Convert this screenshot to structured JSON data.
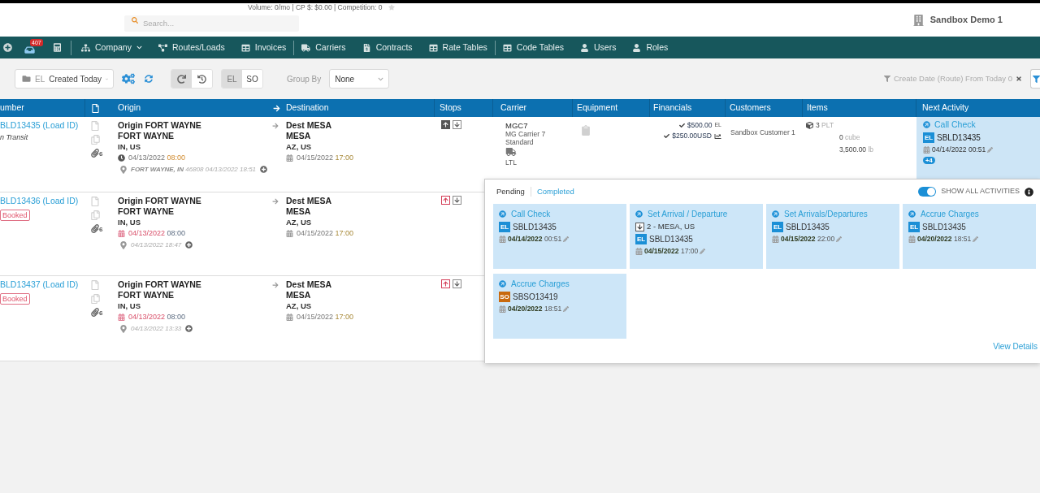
{
  "banner": {
    "text": "Volume: 0/mo | CP $: $0.00 | Competition: 0"
  },
  "header": {
    "search": {
      "placeholder": "Search..."
    },
    "account": "Sandbox Demo 1"
  },
  "nav": {
    "notifications": "407",
    "groups": [
      [
        {
          "label": "Company",
          "has_menu": true
        },
        {
          "label": "Routes/Loads",
          "has_menu": false
        },
        {
          "label": "Invoices",
          "has_menu": false
        }
      ],
      [
        {
          "label": "Carriers",
          "has_menu": false
        },
        {
          "label": "Contracts",
          "has_menu": false
        },
        {
          "label": "Rate Tables",
          "has_menu": false
        }
      ],
      [
        {
          "label": "Code Tables",
          "has_menu": false
        },
        {
          "label": "Users",
          "has_menu": false
        },
        {
          "label": "Roles",
          "has_menu": false
        }
      ]
    ]
  },
  "toolbar": {
    "view": {
      "prefix": "EL",
      "value": "Created Today"
    },
    "history_modes": [
      {
        "selected": true
      },
      {
        "selected": false
      }
    ],
    "doc_types": [
      {
        "label": "EL",
        "selected": true
      },
      {
        "label": "SO",
        "selected": false
      }
    ],
    "group_by": {
      "label": "Group By",
      "value": "None"
    },
    "filter": {
      "label": "Create Date (Route) From Today 0"
    }
  },
  "table": {
    "columns": [
      {
        "kind": "text",
        "label": "umber"
      },
      {
        "kind": "document"
      },
      {
        "kind": "text",
        "label": "Origin"
      },
      {
        "kind": "arrow"
      },
      {
        "kind": "text",
        "label": "Destination"
      },
      {
        "kind": "text",
        "label": "Stops"
      },
      {
        "kind": "text",
        "label": "Carrier"
      },
      {
        "kind": "text",
        "label": "Equipment"
      },
      {
        "kind": "text",
        "label": "Financials"
      },
      {
        "kind": "text",
        "label": "Customers"
      },
      {
        "kind": "text",
        "label": "Items"
      },
      {
        "kind": "text",
        "label": "Next Activity"
      }
    ],
    "rows": [
      {
        "number": "BLD13435 (Load ID)",
        "status": {
          "kind": "plain",
          "label": "n Transit"
        },
        "attachments": "6",
        "origin": {
          "name": "Origin FORT WAYNE",
          "city": "FORT WAYNE",
          "region": "IN, US",
          "arrived": true,
          "late": false,
          "date": "04/13/2022",
          "time": "08:00"
        },
        "last_location": {
          "place": "FORT WAYNE, IN",
          "detail": "46808 04/13/2022 18:51"
        },
        "destination": {
          "name": "Dest MESA",
          "city": "MESA",
          "region": "AZ, US",
          "arrived": false,
          "late": false,
          "date": "04/15/2022",
          "time": "17:00"
        },
        "stops": [
          {
            "done": true,
            "late": false
          },
          {
            "done": false,
            "late": false
          }
        ],
        "carrier": {
          "code": "MGC7",
          "name": "MG Carrier 7",
          "service": "Standard",
          "mode": "LTL"
        },
        "financials": [
          {
            "amount": "$500.00",
            "suffix": "EL",
            "trend": false
          },
          {
            "amount": "$250.00USD",
            "trend": true
          }
        ],
        "customer": "Sandbox Customer 1",
        "items": [
          {
            "value": "3",
            "unit": "PLT"
          },
          {
            "value": "0",
            "unit": "cube"
          },
          {
            "value": "3,500.00",
            "unit": "lb"
          }
        ],
        "next_activity": {
          "title": "Call Check",
          "doc": {
            "type": "EL",
            "id": "SBLD13435",
            "color": "#1b8fd6"
          },
          "date": "04/14/2022",
          "time": "00:51",
          "more": "+4"
        }
      },
      {
        "number": "BLD13436 (Load ID)",
        "status": {
          "kind": "badge",
          "label": "Booked"
        },
        "attachments": "6",
        "origin": {
          "name": "Origin FORT WAYNE",
          "city": "FORT WAYNE",
          "region": "IN, US",
          "arrived": false,
          "late": true,
          "date": "04/13/2022",
          "time": "08:00"
        },
        "last_location": {
          "detail": "04/13/2022 18:47"
        },
        "destination": {
          "name": "Dest MESA",
          "city": "MESA",
          "region": "AZ, US",
          "arrived": false,
          "late": false,
          "date": "04/15/2022",
          "time": "17:00"
        },
        "stops": [
          {
            "done": false,
            "late": true
          },
          {
            "done": false,
            "late": false
          }
        ]
      },
      {
        "number": "BLD13437 (Load ID)",
        "status": {
          "kind": "badge",
          "label": "Booked"
        },
        "attachments": "6",
        "origin": {
          "name": "Origin FORT WAYNE",
          "city": "FORT WAYNE",
          "region": "IN, US",
          "arrived": false,
          "late": true,
          "date": "04/13/2022",
          "time": "08:00"
        },
        "last_location": {
          "detail": "04/13/2022 13:33"
        },
        "destination": {
          "name": "Dest MESA",
          "city": "MESA",
          "region": "AZ, US",
          "arrived": false,
          "late": false,
          "date": "04/15/2022",
          "time": "17:00"
        },
        "stops": [
          {
            "done": false,
            "late": true
          },
          {
            "done": false,
            "late": false
          }
        ]
      }
    ]
  },
  "activity_popup": {
    "tabs": [
      {
        "label": "Pending",
        "selected": true
      },
      {
        "label": "Completed",
        "selected": false
      }
    ],
    "show_all": {
      "label": "SHOW ALL ACTIVITIES",
      "on": true
    },
    "cards": [
      {
        "title": "Call Check",
        "doc": {
          "type": "EL",
          "id": "SBLD13435",
          "color": "#1b8fd6"
        },
        "date": "04/14/2022",
        "time": "00:51"
      },
      {
        "title": "Set Arrival / Departure",
        "stop": "2 - MESA, US",
        "doc": {
          "type": "EL",
          "id": "SBLD13435",
          "color": "#1b8fd6"
        },
        "date": "04/15/2022",
        "time": "17:00"
      },
      {
        "title": "Set Arrivals/Departures",
        "doc": {
          "type": "EL",
          "id": "SBLD13435",
          "color": "#1b8fd6"
        },
        "date": "04/15/2022",
        "time": "22:00"
      },
      {
        "title": "Accrue Charges",
        "doc": {
          "type": "EL",
          "id": "SBLD13435",
          "color": "#1b8fd6"
        },
        "date": "04/20/2022",
        "time": "18:51"
      },
      {
        "title": "Accrue Charges",
        "doc": {
          "type": "SO",
          "id": "SBSO13419",
          "color": "#c8690e"
        },
        "date": "04/20/2022",
        "time": "18:51"
      }
    ],
    "view_details": "View Details"
  }
}
